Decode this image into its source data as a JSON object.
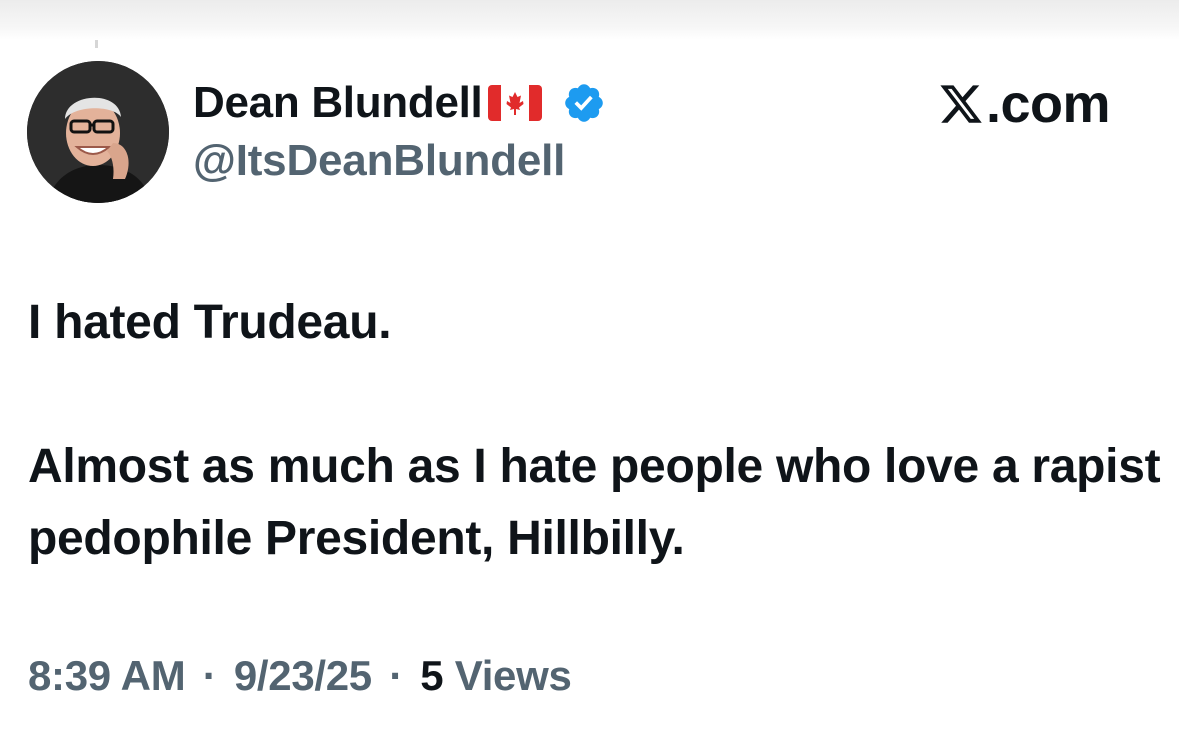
{
  "author": {
    "display_name": "Dean Blundell",
    "flag_icon": "canada-flag-icon",
    "verified_icon": "verified-badge-icon",
    "verified_color": "#1d9bf0",
    "handle": "@ItsDeanBlundell"
  },
  "brand": {
    "logo_icon": "x-logo-icon",
    "text": ".com"
  },
  "tweet": {
    "paragraphs": [
      "I hated Trudeau.",
      "Almost as much as I hate people who love a rapist pedophile President, Hillbilly."
    ]
  },
  "meta": {
    "time": "8:39 AM",
    "separator": "·",
    "date": "9/23/25",
    "views_count": "5",
    "views_label": "Views"
  },
  "colors": {
    "text_primary": "#0f1419",
    "text_secondary": "#536471",
    "background": "#ffffff"
  }
}
